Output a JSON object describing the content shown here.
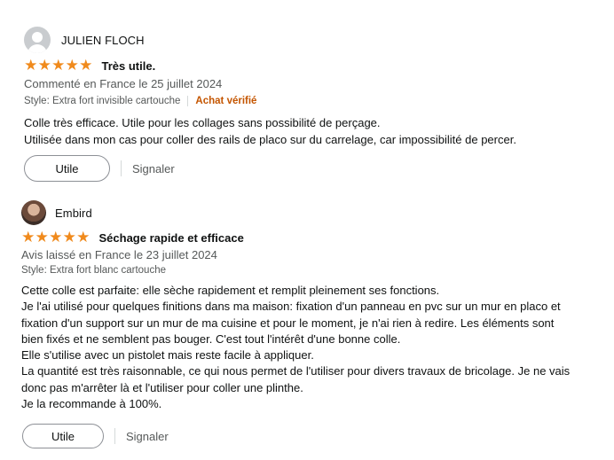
{
  "reviews": [
    {
      "author": "JULIEN FLOCH",
      "avatar": "default-user-icon",
      "rating": 5,
      "stars": [
        "★",
        "★",
        "★",
        "★",
        "★"
      ],
      "title": "Très utile.",
      "date": "Commenté en France le 25 juillet 2024",
      "style": "Style: Extra fort invisible cartouche",
      "verified": "Achat vérifié",
      "body": [
        "Colle très efficace. Utile pour les collages sans possibilité de perçage.",
        "Utilisée dans mon cas pour coller des rails de placo sur du carrelage, car impossibilité de percer."
      ],
      "helpful_label": "Utile",
      "report_label": "Signaler"
    },
    {
      "author": "Embird",
      "avatar": "user-photo",
      "rating": 5,
      "stars": [
        "★",
        "★",
        "★",
        "★",
        "★"
      ],
      "title": "Séchage rapide et efficace",
      "date": "Avis laissé en France le 23 juillet 2024",
      "style": "Style: Extra fort blanc cartouche",
      "body": [
        "Cette colle est parfaite: elle sèche rapidement et remplit pleinement ses fonctions.",
        "Je l'ai utilisé pour quelques finitions dans ma maison: fixation d'un panneau en pvc sur un mur en placo et",
        "fixation d'un support sur un mur de ma cuisine et pour le moment, je n'ai rien à redire. Les éléments sont",
        "bien fixés et ne semblent pas bouger. C'est tout l'intérêt d'une bonne colle.",
        "Elle s'utilise avec un pistolet mais reste facile à appliquer.",
        "La quantité est très raisonnable, ce qui nous permet de l'utiliser pour divers travaux de bricolage. Je ne vais",
        "donc pas m'arrêter là et l'utiliser pour coller une plinthe.",
        "Je la recommande à 100%."
      ],
      "helpful_label": "Utile",
      "report_label": "Signaler"
    }
  ],
  "colors": {
    "star": "#f08a1c",
    "verified": "#c45500",
    "muted": "#565959",
    "text": "#0f1111"
  }
}
